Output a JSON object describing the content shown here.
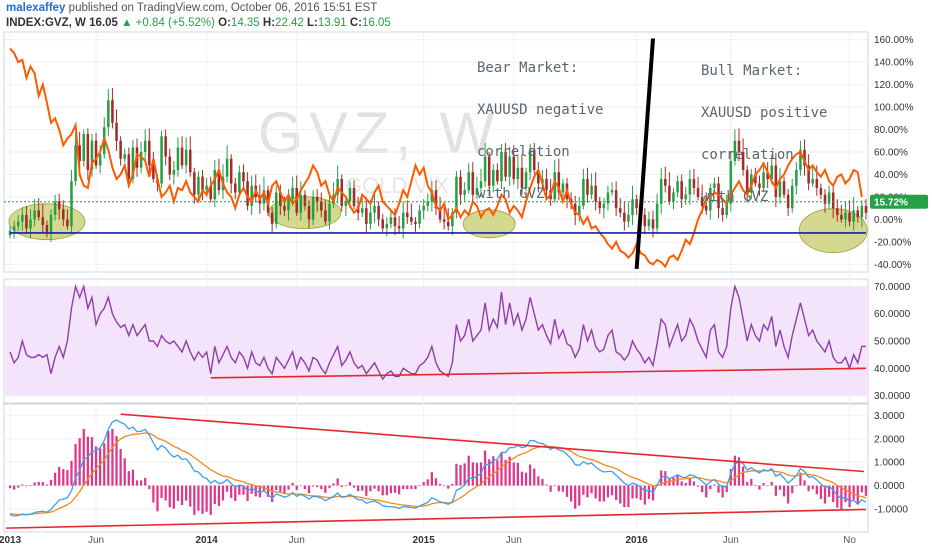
{
  "header": {
    "author": "malexaffey",
    "published": "published on TradingView.com, October 06, 2016 15:51 EST",
    "symbol": "INDEX:GVZ, W",
    "last": "16.05",
    "change": "+0.84 (+5.52%)",
    "o_label": "O:",
    "o_value": "14.35",
    "h_label": "H:",
    "h_value": "22.42",
    "l_label": "L:",
    "l_value": "13.91",
    "c_label": "C:",
    "c_value": "16.05"
  },
  "watermark": {
    "symbol": "GVZ, W",
    "name": "GOLD VIX"
  },
  "annotations": {
    "bear": [
      "Bear Market:",
      "XAUUSD negative",
      "correlation",
      "with GVZ"
    ],
    "bull": [
      "Bull Market:",
      "XAUUSD positive",
      "correlation",
      "with GVZ"
    ]
  },
  "colors": {
    "up_candle": "#26a046",
    "down_candle": "#a52a2a",
    "overlay_line": "#ff5a00",
    "support_line": "#1b1bb0",
    "rsi_line": "#8e3fa8",
    "rsi_band": "#f3e3fb",
    "trend_line": "#e8262d",
    "macd_line": "#3da0e8",
    "signal_line": "#f28a1b",
    "histogram": "#e0368a",
    "highlight": "#c6cc6a",
    "divider": "#000000",
    "last_price_badge": "#26a046"
  },
  "chart_data": [
    {
      "type": "candlestick",
      "name": "INDEX:GVZ, W",
      "y_axis": {
        "unit": "%",
        "ticks": [
          "160.00%",
          "140.00%",
          "120.00%",
          "100.00%",
          "80.00%",
          "60.00%",
          "40.00%",
          "20.00%",
          "0.00%",
          "-20.00%",
          "-40.00%"
        ],
        "range": [
          -45,
          165
        ]
      },
      "x_axis": {
        "ticks": [
          "2013",
          "Jun",
          "2014",
          "Jun",
          "2015",
          "Jun",
          "2016",
          "Jun",
          "No"
        ]
      },
      "last_value_label": "15.72%",
      "gvz_pct": [
        -10,
        -6,
        -2,
        4,
        -8,
        0,
        8,
        2,
        -5,
        -12,
        4,
        16,
        9,
        0,
        -6,
        34,
        66,
        52,
        76,
        44,
        70,
        48,
        58,
        82,
        106,
        86,
        70,
        54,
        58,
        36,
        64,
        46,
        60,
        70,
        48,
        36,
        32,
        74,
        56,
        40,
        44,
        64,
        48,
        62,
        42,
        22,
        38,
        26,
        30,
        18,
        44,
        26,
        38,
        54,
        32,
        24,
        42,
        34,
        12,
        30,
        20,
        14,
        26,
        6,
        -4,
        24,
        12,
        8,
        18,
        28,
        6,
        22,
        12,
        0,
        20,
        16,
        8,
        -2,
        14,
        22,
        36,
        12,
        16,
        28,
        12,
        6,
        10,
        -4,
        6,
        12,
        0,
        -8,
        -4,
        2,
        -6,
        -8,
        6,
        2,
        -2,
        -4,
        8,
        12,
        16,
        26,
        10,
        0,
        -2,
        -6,
        6,
        38,
        22,
        26,
        42,
        22,
        28,
        34,
        56,
        30,
        44,
        34,
        60,
        38,
        56,
        36,
        46,
        28,
        42,
        62,
        44,
        32,
        36,
        26,
        18,
        42,
        24,
        32,
        18,
        14,
        4,
        12,
        36,
        22,
        30,
        16,
        10,
        14,
        24,
        26,
        10,
        6,
        -2,
        4,
        18,
        10,
        4,
        -6,
        0,
        -8,
        14,
        36,
        30,
        16,
        24,
        34,
        18,
        22,
        36,
        28,
        20,
        12,
        8,
        28,
        32,
        10,
        4,
        14,
        52,
        70,
        60,
        44,
        24,
        40,
        32,
        28,
        42,
        36,
        48,
        20,
        34,
        22,
        10,
        30,
        44,
        62,
        48,
        32,
        36,
        28,
        22,
        14,
        24,
        10,
        4,
        0,
        6,
        -2,
        8,
        2,
        12,
        6
      ],
      "xauusd_overlay_pct": [
        152,
        148,
        140,
        142,
        126,
        136,
        130,
        110,
        120,
        104,
        86,
        90,
        80,
        66,
        72,
        76,
        84,
        40,
        30,
        28,
        50,
        54,
        60,
        72,
        62,
        46,
        36,
        40,
        48,
        30,
        40,
        58,
        56,
        52,
        38,
        54,
        36,
        20,
        24,
        30,
        16,
        28,
        26,
        34,
        24,
        20,
        16,
        26,
        22,
        30,
        36,
        44,
        32,
        24,
        20,
        10,
        22,
        28,
        20,
        16,
        26,
        18,
        24,
        14,
        30,
        34,
        24,
        16,
        22,
        14,
        18,
        26,
        32,
        38,
        48,
        42,
        30,
        34,
        22,
        16,
        28,
        24,
        20,
        12,
        6,
        10,
        22,
        18,
        14,
        24,
        30,
        16,
        12,
        8,
        4,
        14,
        26,
        20,
        34,
        48,
        40,
        46,
        30,
        24,
        12,
        8,
        14,
        0,
        4,
        10,
        2,
        8,
        4,
        16,
        12,
        2,
        8,
        10,
        4,
        12,
        22,
        18,
        6,
        12,
        8,
        2,
        16,
        28,
        38,
        44,
        32,
        18,
        22,
        34,
        28,
        16,
        26,
        14,
        6,
        4,
        -4,
        2,
        -8,
        -6,
        -12,
        -16,
        -22,
        -26,
        -20,
        -28,
        -30,
        -34,
        -30,
        -22,
        -30,
        -32,
        -38,
        -40,
        -36,
        -38,
        -42,
        -34,
        -32,
        -36,
        -28,
        -18,
        -22,
        -12,
        0,
        8,
        18,
        20,
        24,
        22,
        18,
        14,
        22,
        28,
        34,
        26,
        22,
        30,
        40,
        44,
        50,
        42,
        34,
        28,
        36,
        40,
        48,
        54,
        58,
        60,
        52,
        44,
        48,
        42,
        38,
        44,
        34,
        30,
        38,
        40,
        32,
        36,
        44,
        42,
        20
      ]
    },
    {
      "type": "line",
      "name": "RSI",
      "y_axis": {
        "ticks": [
          "70.0000",
          "60.0000",
          "50.0000",
          "40.0000",
          "30.0000"
        ],
        "range": [
          28,
          72
        ]
      },
      "values": [
        46,
        42,
        44,
        50,
        45,
        44,
        44,
        45,
        44,
        45,
        38,
        44,
        48,
        44,
        50,
        62,
        70,
        66,
        70,
        62,
        66,
        56,
        60,
        62,
        66,
        60,
        57,
        55,
        56,
        52,
        56,
        52,
        54,
        56,
        50,
        50,
        48,
        52,
        50,
        49,
        50,
        48,
        46,
        50,
        46,
        43,
        46,
        44,
        46,
        38,
        48,
        42,
        45,
        48,
        44,
        42,
        46,
        44,
        40,
        46,
        42,
        41,
        44,
        40,
        38,
        44,
        42,
        40,
        43,
        46,
        40,
        44,
        42,
        39,
        44,
        43,
        40,
        38,
        42,
        45,
        48,
        41,
        43,
        46,
        42,
        40,
        41,
        38,
        40,
        42,
        39,
        36,
        38,
        39,
        37,
        37,
        40,
        39,
        38,
        38,
        41,
        42,
        44,
        48,
        42,
        39,
        38,
        37,
        42,
        56,
        50,
        52,
        58,
        50,
        52,
        54,
        64,
        54,
        58,
        55,
        68,
        56,
        64,
        56,
        60,
        54,
        58,
        66,
        60,
        54,
        56,
        52,
        49,
        58,
        51,
        54,
        49,
        48,
        44,
        47,
        56,
        50,
        54,
        48,
        46,
        47,
        52,
        54,
        46,
        45,
        43,
        45,
        50,
        47,
        45,
        42,
        44,
        41,
        49,
        58,
        56,
        48,
        52,
        56,
        50,
        52,
        58,
        55,
        50,
        47,
        44,
        54,
        56,
        46,
        44,
        48,
        62,
        70,
        66,
        58,
        50,
        56,
        52,
        50,
        56,
        54,
        59,
        48,
        54,
        48,
        44,
        52,
        58,
        64,
        58,
        52,
        54,
        50,
        48,
        46,
        50,
        44,
        42,
        42,
        44,
        40,
        45,
        42,
        48,
        48
      ]
    },
    {
      "type": "line",
      "name": "MACD",
      "y_axis": {
        "ticks": [
          "3.0000",
          "2.0000",
          "1.0000",
          "0.0000",
          "-1.0000"
        ],
        "range": [
          -1.9,
          3.4
        ]
      },
      "macd": [
        -1.25,
        -1.3,
        -1.28,
        -1.22,
        -1.25,
        -1.22,
        -1.15,
        -1.12,
        -1.1,
        -1.14,
        -1.02,
        -0.82,
        -0.62,
        -0.58,
        -0.52,
        -0.22,
        0.32,
        0.66,
        1.12,
        1.22,
        1.46,
        1.48,
        1.62,
        1.92,
        2.42,
        2.72,
        2.8,
        2.7,
        2.62,
        2.42,
        2.5,
        2.3,
        2.32,
        2.4,
        2.16,
        1.82,
        1.52,
        1.72,
        1.6,
        1.36,
        1.22,
        1.3,
        1.12,
        1.14,
        0.92,
        0.62,
        0.58,
        0.38,
        0.3,
        0.1,
        0.22,
        0.08,
        0.12,
        0.26,
        0.08,
        -0.06,
        0.02,
        -0.02,
        -0.22,
        -0.12,
        -0.22,
        -0.3,
        -0.22,
        -0.38,
        -0.56,
        -0.36,
        -0.42,
        -0.5,
        -0.44,
        -0.3,
        -0.46,
        -0.38,
        -0.46,
        -0.58,
        -0.46,
        -0.48,
        -0.54,
        -0.64,
        -0.56,
        -0.46,
        -0.32,
        -0.5,
        -0.48,
        -0.38,
        -0.5,
        -0.6,
        -0.62,
        -0.76,
        -0.7,
        -0.66,
        -0.74,
        -0.86,
        -0.9,
        -0.9,
        -0.92,
        -0.98,
        -0.9,
        -0.92,
        -0.94,
        -0.96,
        -0.88,
        -0.8,
        -0.72,
        -0.52,
        -0.6,
        -0.7,
        -0.74,
        -0.8,
        -0.7,
        -0.2,
        -0.12,
        0.02,
        0.32,
        0.3,
        0.4,
        0.52,
        0.92,
        0.88,
        1.08,
        1.12,
        1.42,
        1.42,
        1.62,
        1.62,
        1.72,
        1.62,
        1.66,
        1.92,
        1.92,
        1.82,
        1.8,
        1.7,
        1.54,
        1.64,
        1.52,
        1.48,
        1.32,
        1.16,
        0.9,
        0.86,
        1.02,
        0.92,
        0.96,
        0.8,
        0.66,
        0.58,
        0.6,
        0.6,
        0.44,
        0.28,
        0.1,
        0.0,
        0.1,
        0.04,
        -0.06,
        -0.24,
        -0.2,
        -0.3,
        0.02,
        0.36,
        0.42,
        0.3,
        0.36,
        0.46,
        0.36,
        0.34,
        0.46,
        0.42,
        0.32,
        0.18,
        0.02,
        0.16,
        0.26,
        0.06,
        -0.08,
        -0.02,
        0.52,
        0.92,
        1.02,
        0.94,
        0.66,
        0.76,
        0.64,
        0.54,
        0.68,
        0.62,
        0.72,
        0.4,
        0.5,
        0.32,
        0.1,
        0.26,
        0.42,
        0.72,
        0.6,
        0.36,
        0.38,
        0.24,
        0.08,
        -0.1,
        -0.02,
        -0.2,
        -0.42,
        -0.56,
        -0.5,
        -0.7,
        -0.62,
        -0.8,
        -0.6,
        -0.72
      ],
      "signal": [
        -1.2,
        -1.22,
        -1.24,
        -1.24,
        -1.24,
        -1.23,
        -1.21,
        -1.19,
        -1.17,
        -1.16,
        -1.13,
        -1.07,
        -0.98,
        -0.9,
        -0.82,
        -0.7,
        -0.49,
        -0.26,
        0.02,
        0.27,
        0.52,
        0.72,
        0.9,
        1.1,
        1.36,
        1.62,
        1.84,
        1.99,
        2.09,
        2.14,
        2.19,
        2.2,
        2.22,
        2.25,
        2.23,
        2.15,
        2.02,
        1.96,
        1.89,
        1.78,
        1.67,
        1.6,
        1.5,
        1.43,
        1.33,
        1.19,
        1.07,
        0.93,
        0.81,
        0.67,
        0.58,
        0.48,
        0.41,
        0.38,
        0.32,
        0.24,
        0.2,
        0.16,
        0.08,
        0.04,
        -0.01,
        -0.07,
        -0.1,
        -0.16,
        -0.24,
        -0.27,
        -0.3,
        -0.34,
        -0.36,
        -0.35,
        -0.37,
        -0.37,
        -0.39,
        -0.43,
        -0.44,
        -0.45,
        -0.47,
        -0.5,
        -0.51,
        -0.5,
        -0.46,
        -0.47,
        -0.47,
        -0.45,
        -0.46,
        -0.49,
        -0.52,
        -0.56,
        -0.59,
        -0.6,
        -0.63,
        -0.67,
        -0.71,
        -0.75,
        -0.78,
        -0.81,
        -0.83,
        -0.85,
        -0.87,
        -0.89,
        -0.89,
        -0.87,
        -0.84,
        -0.78,
        -0.74,
        -0.73,
        -0.73,
        -0.74,
        -0.73,
        -0.62,
        -0.52,
        -0.41,
        -0.26,
        -0.15,
        -0.04,
        0.07,
        0.24,
        0.37,
        0.51,
        0.63,
        0.79,
        0.92,
        1.06,
        1.17,
        1.28,
        1.35,
        1.41,
        1.51,
        1.59,
        1.64,
        1.67,
        1.68,
        1.66,
        1.65,
        1.63,
        1.6,
        1.54,
        1.47,
        1.35,
        1.25,
        1.2,
        1.15,
        1.11,
        1.05,
        0.97,
        0.89,
        0.83,
        0.79,
        0.72,
        0.63,
        0.52,
        0.42,
        0.35,
        0.29,
        0.22,
        0.13,
        0.06,
        -0.01,
        0.0,
        0.07,
        0.14,
        0.17,
        0.21,
        0.26,
        0.28,
        0.29,
        0.32,
        0.34,
        0.34,
        0.31,
        0.25,
        0.23,
        0.24,
        0.2,
        0.15,
        0.11,
        0.2,
        0.34,
        0.47,
        0.57,
        0.59,
        0.63,
        0.63,
        0.62,
        0.63,
        0.63,
        0.65,
        0.6,
        0.58,
        0.53,
        0.45,
        0.41,
        0.41,
        0.47,
        0.5,
        0.47,
        0.45,
        0.41,
        0.34,
        0.25,
        0.2,
        0.12,
        0.01,
        -0.1,
        -0.18,
        -0.28,
        -0.35,
        -0.44,
        -0.47,
        -0.52
      ]
    }
  ]
}
